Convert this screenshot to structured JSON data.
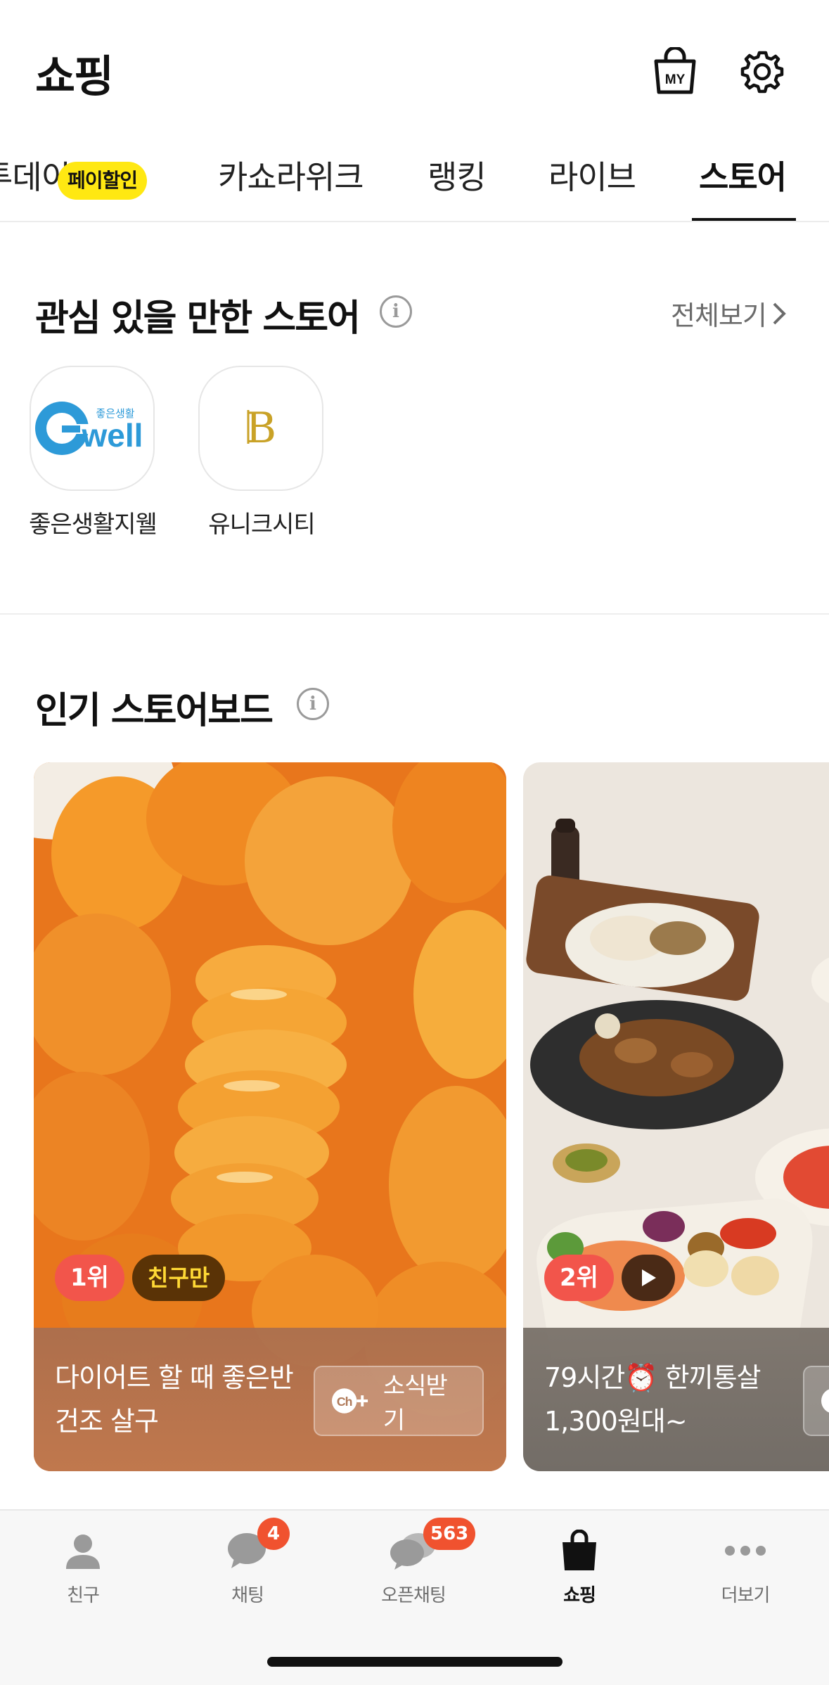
{
  "header": {
    "title": "쇼핑",
    "my_icon_text": "MY",
    "icons": [
      "shopping-bag-my-icon",
      "gear-icon"
    ]
  },
  "tabs": [
    {
      "label": "투데이",
      "badge": "페이할인"
    },
    {
      "label": "카쇼라위크"
    },
    {
      "label": "랭킹"
    },
    {
      "label": "라이브"
    },
    {
      "label": "스토어",
      "active": true
    }
  ],
  "stores_section": {
    "title": "관심 있을 만한 스토어",
    "view_all": "전체보기",
    "stores": [
      {
        "name": "좋은생활지웰",
        "logo_small": "좋은생활",
        "logo_big": "well"
      },
      {
        "name": "유니크시티",
        "logo_big": "B"
      }
    ]
  },
  "storeboard_section": {
    "title": "인기 스토어보드",
    "cards": [
      {
        "rank": "1위",
        "tag": "친구만",
        "line1": "다이어트 할 때 좋은반",
        "line2": "건조 살구",
        "follow": "소식받기"
      },
      {
        "rank": "2위",
        "line1": "79시간⏰ 한끼통살",
        "line2": "1,300원대~",
        "follow": ""
      }
    ]
  },
  "bottom_nav": [
    {
      "label": "친구",
      "icon": "person-icon"
    },
    {
      "label": "채팅",
      "icon": "chat-icon",
      "badge": "4"
    },
    {
      "label": "오픈채팅",
      "icon": "open-chat-icon",
      "badge": "563"
    },
    {
      "label": "쇼핑",
      "icon": "shopping-bag-icon",
      "active": true
    },
    {
      "label": "더보기",
      "icon": "more-dots-icon"
    }
  ],
  "colors": {
    "accent_yellow": "#ffe812",
    "rank_red": "#f2554b",
    "badge_orange": "#f0522f"
  }
}
